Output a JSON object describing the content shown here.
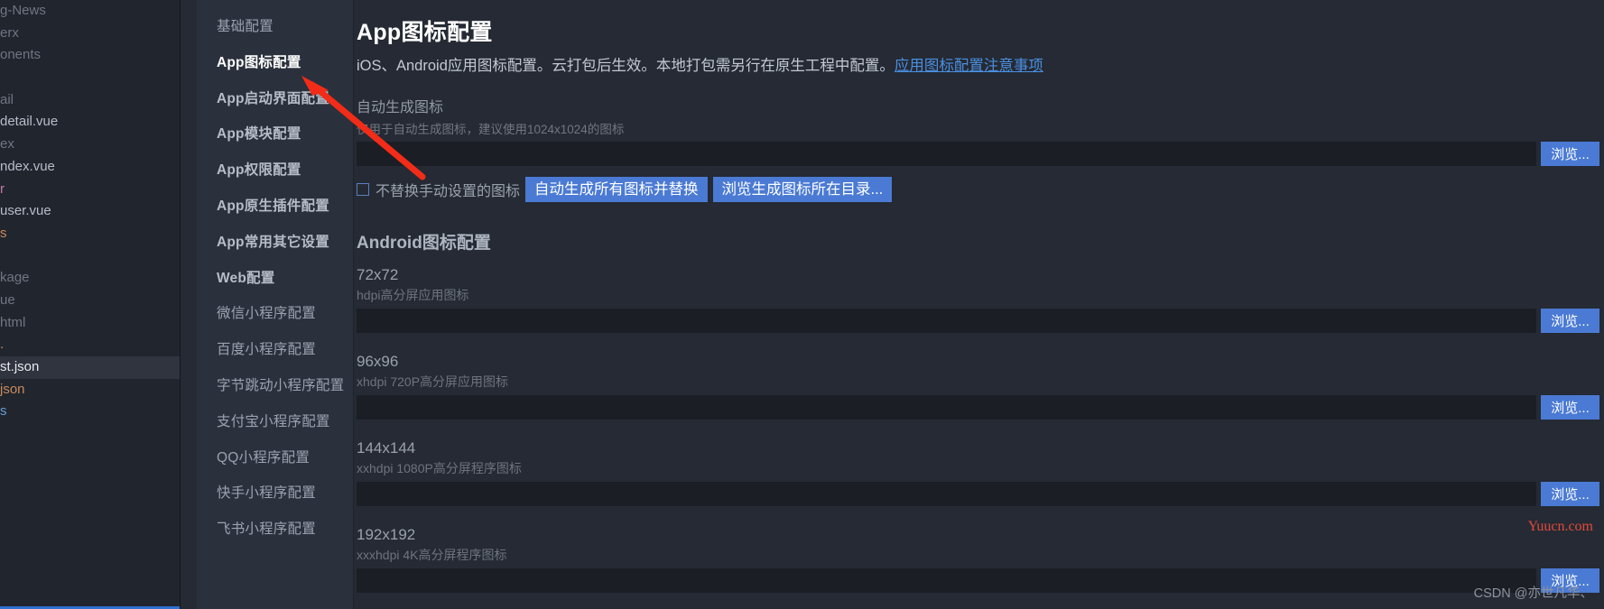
{
  "explorer": {
    "files": [
      {
        "label": "g-News",
        "style": "dim"
      },
      {
        "label": "erx",
        "style": "dim"
      },
      {
        "label": "onents",
        "style": "dim"
      },
      {
        "label": "",
        "style": "dim"
      },
      {
        "label": "ail",
        "style": "dim"
      },
      {
        "label": "detail.vue",
        "style": "vue"
      },
      {
        "label": "ex",
        "style": "dim"
      },
      {
        "label": "ndex.vue",
        "style": "vue"
      },
      {
        "label": "r",
        "style": "pink"
      },
      {
        "label": "user.vue",
        "style": "vue"
      },
      {
        "label": "s",
        "style": "orange"
      },
      {
        "label": "",
        "style": "dim"
      },
      {
        "label": "kage",
        "style": "dim"
      },
      {
        "label": "ue",
        "style": "dim"
      },
      {
        "label": "html",
        "style": "dim"
      },
      {
        "label": ".",
        "style": "orange"
      },
      {
        "label": "st.json",
        "style": "selected"
      },
      {
        "label": "json",
        "style": "orange"
      },
      {
        "label": "s",
        "style": "blue"
      }
    ]
  },
  "nav": {
    "items": [
      {
        "label": "基础配置",
        "state": "normal"
      },
      {
        "label": "App图标配置",
        "state": "active"
      },
      {
        "label": "App启动界面配置",
        "state": "bold"
      },
      {
        "label": "App模块配置",
        "state": "bold"
      },
      {
        "label": "App权限配置",
        "state": "bold"
      },
      {
        "label": "App原生插件配置",
        "state": "bold"
      },
      {
        "label": "App常用其它设置",
        "state": "bold"
      },
      {
        "label": "Web配置",
        "state": "bold"
      },
      {
        "label": "微信小程序配置",
        "state": "normal"
      },
      {
        "label": "百度小程序配置",
        "state": "normal"
      },
      {
        "label": "字节跳动小程序配置",
        "state": "normal"
      },
      {
        "label": "支付宝小程序配置",
        "state": "normal"
      },
      {
        "label": "QQ小程序配置",
        "state": "normal"
      },
      {
        "label": "快手小程序配置",
        "state": "normal"
      },
      {
        "label": "飞书小程序配置",
        "state": "normal"
      }
    ]
  },
  "main": {
    "title": "App图标配置",
    "subtitle_text": "iOS、Android应用图标配置。云打包后生效。本地打包需另行在原生工程中配置。",
    "subtitle_link": "应用图标配置注意事项",
    "auto_generate": {
      "label": "自动生成图标",
      "hint": "仅用于自动生成图标，建议使用1024x1024的图标",
      "value": "",
      "placeholder": "",
      "browse_label": "浏览..."
    },
    "checkbox_label": "不替换手动设置的图标",
    "checkbox_checked": false,
    "generate_all_button": "自动生成所有图标并替换",
    "browse_dir_button": "浏览生成图标所在目录...",
    "android_heading": "Android图标配置",
    "browse_label": "浏览...",
    "icons": [
      {
        "size": "72x72",
        "hint": "hdpi高分屏应用图标",
        "value": ""
      },
      {
        "size": "96x96",
        "hint": "xhdpi 720P高分屏应用图标",
        "value": ""
      },
      {
        "size": "144x144",
        "hint": "xxhdpi 1080P高分屏程序图标",
        "value": ""
      },
      {
        "size": "192x192",
        "hint": "xxxhdpi 4K高分屏程序图标",
        "value": ""
      }
    ]
  },
  "watermarks": {
    "yuucn": "Yuucn.com",
    "csdn": "CSDN @亦世凡华、"
  },
  "colors": {
    "accent": "#4a7ad4",
    "link": "#4a8fe0",
    "arrow": "#f22c18",
    "panel_bg": "#2b313c",
    "content_bg": "#252a34",
    "explorer_bg": "#21252e"
  }
}
